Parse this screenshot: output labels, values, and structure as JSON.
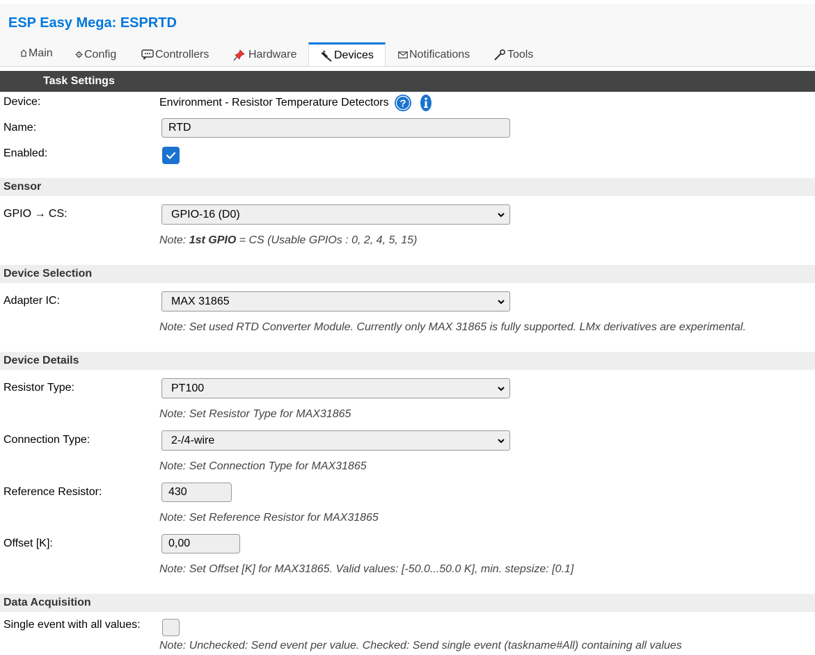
{
  "app": {
    "title": "ESP Easy Mega: ESPRTD"
  },
  "tabs": [
    {
      "label": "Main",
      "icon": "home-icon"
    },
    {
      "label": "Config",
      "icon": "gear-icon"
    },
    {
      "label": "Controllers",
      "icon": "chat-icon"
    },
    {
      "label": "Hardware",
      "icon": "pin-icon"
    },
    {
      "label": "Devices",
      "icon": "plug-icon",
      "active": true
    },
    {
      "label": "Notifications",
      "icon": "mail-icon"
    },
    {
      "label": "Tools",
      "icon": "wrench-icon"
    }
  ],
  "task": {
    "header": "Task Settings",
    "device_label": "Device:",
    "device_value": "Environment - Resistor Temperature Detectors",
    "name_label": "Name:",
    "name_value": "RTD",
    "enabled_label": "Enabled:",
    "enabled": true
  },
  "sensor": {
    "header": "Sensor",
    "gpio_label": "GPIO → CS:",
    "gpio_value": "GPIO-16 (D0)",
    "note_prefix": "Note: ",
    "note_bold": "1st GPIO",
    "note_rest": " = CS (Usable GPIOs : 0, 2, 4, 5, 15)"
  },
  "device_selection": {
    "header": "Device Selection",
    "adapter_label": "Adapter IC:",
    "adapter_value": "MAX 31865",
    "note": "Note: Set used RTD Converter Module. Currently only MAX 31865 is fully supported. LMx derivatives are experimental."
  },
  "device_details": {
    "header": "Device Details",
    "resistor_type_label": "Resistor Type:",
    "resistor_type_value": "PT100",
    "resistor_type_note": "Note: Set Resistor Type for MAX31865",
    "connection_type_label": "Connection Type:",
    "connection_type_value": "2-/4-wire",
    "connection_type_note": "Note: Set Connection Type for MAX31865",
    "reference_label": "Reference Resistor:",
    "reference_value": "430",
    "reference_note": "Note: Set Reference Resistor for MAX31865",
    "offset_label": "Offset [K]:",
    "offset_value": "0,00",
    "offset_note": "Note: Set Offset [K] for MAX31865. Valid values: [-50.0...50.0 K], min. stepsize: [0.1]"
  },
  "data_acquisition": {
    "header": "Data Acquisition",
    "single_event_label": "Single event with all values:",
    "single_event": false,
    "single_event_note": "Note: Unchecked: Send event per value. Checked: Send single event (taskname#All) containing all values"
  },
  "colors": {
    "accent": "#0077dd",
    "header_bg": "#444444",
    "section_bg": "#eeeeee",
    "checkbox_on": "#1a73d0"
  }
}
